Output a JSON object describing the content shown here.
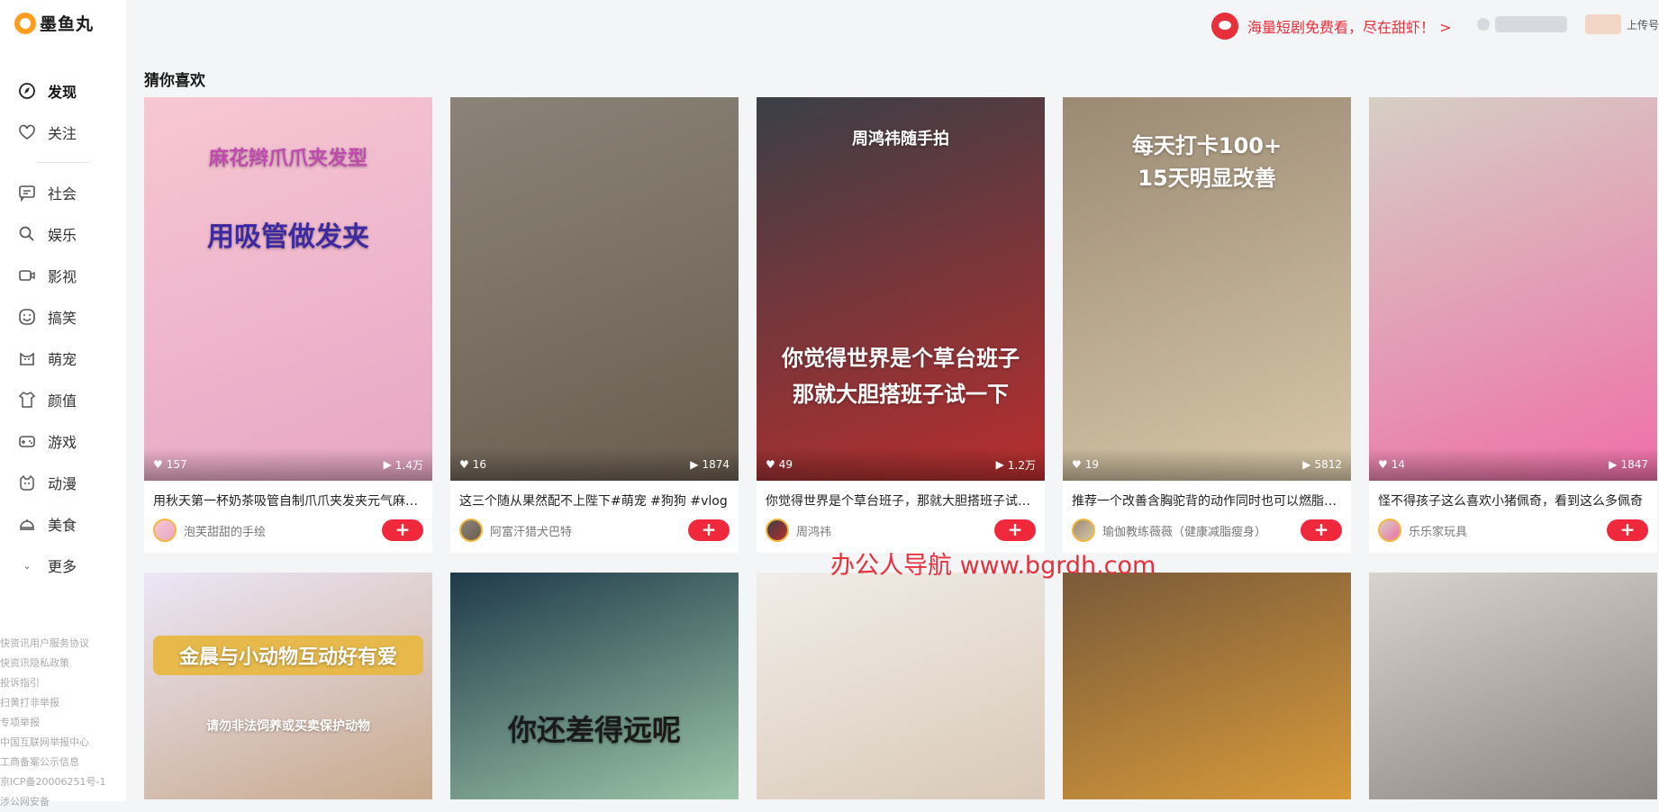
{
  "app": {
    "name": "墨鱼丸"
  },
  "nav": {
    "items": [
      {
        "label": "发现",
        "icon": "compass-icon",
        "active": true
      },
      {
        "label": "关注",
        "icon": "heart-face-icon"
      },
      {
        "label": "社会",
        "icon": "chat-icon"
      },
      {
        "label": "娱乐",
        "icon": "search-icon"
      },
      {
        "label": "影视",
        "icon": "video-camera-icon"
      },
      {
        "label": "搞笑",
        "icon": "smile-icon"
      },
      {
        "label": "萌宠",
        "icon": "cat-icon"
      },
      {
        "label": "颜值",
        "icon": "tshirt-icon"
      },
      {
        "label": "游戏",
        "icon": "gamepad-icon"
      },
      {
        "label": "动漫",
        "icon": "anime-face-icon"
      },
      {
        "label": "美食",
        "icon": "dish-icon"
      }
    ],
    "more": "更多"
  },
  "footer_links": [
    "快资讯用户服务协议",
    "快资讯隐私政策",
    "投诉指引",
    "扫黄打非举报",
    "专项举报",
    "中国互联网举报中心",
    "工商备案公示信息",
    "京ICP备20006251号-1",
    "涉公网安备"
  ],
  "header": {
    "promo": "海量短剧免费看，尽在甜虾！ >",
    "upload": "上传号"
  },
  "section": {
    "title": "猜你喜欢"
  },
  "cards": [
    {
      "title": "用秋天第一杯奶茶吸管自制爪爪夹发夹元气麻花辫",
      "author": "泡芙甜甜的手绘",
      "likes": "157",
      "plays": "1.4万",
      "overlay": [
        "麻花辫爪爪夹发型",
        "用吸管做发夹"
      ],
      "colors": [
        "#f7c7d3",
        "#e7a6c5"
      ]
    },
    {
      "title": "这三个随从果然配不上陛下#萌宠 #狗狗 #vlog",
      "author": "阿富汗猎犬巴特",
      "likes": "16",
      "plays": "1874",
      "overlay": [],
      "colors": [
        "#8b8378",
        "#6a5d4f"
      ]
    },
    {
      "title": "你觉得世界是个草台班子，那就大胆搭班子试一下",
      "author": "周鸿祎",
      "likes": "49",
      "plays": "1.2万",
      "overlay": [
        "周鸿祎随手拍",
        "你觉得世界是个草台班子",
        "那就大胆搭班子试一下"
      ],
      "colors": [
        "#3a3f47",
        "#b92d2d"
      ]
    },
    {
      "title": "推荐一个改善含胸驼背的动作同时也可以燃脂瘦身",
      "author": "瑜伽教练薇薇（健康减脂瘦身）",
      "likes": "19",
      "plays": "5812",
      "overlay": [
        "每天打卡100+",
        "15天明显改善"
      ],
      "colors": [
        "#9b8a74",
        "#d8c8a8"
      ]
    },
    {
      "title": "怪不得孩子这么喜欢小猪佩奇，看到这么多佩奇",
      "author": "乐乐家玩具",
      "likes": "14",
      "plays": "1847",
      "overlay": [],
      "colors": [
        "#d6cfc5",
        "#ef6fa8"
      ]
    },
    {
      "title": "",
      "author": "",
      "likes": "",
      "plays": "",
      "overlay": [
        "金晨与小动物互动好有爱",
        "请勿非法饲养或买卖保护动物"
      ],
      "colors": [
        "#ece6f7",
        "#c8a98c"
      ]
    },
    {
      "title": "",
      "author": "",
      "likes": "",
      "plays": "",
      "overlay": [
        "你还差得远呢"
      ],
      "colors": [
        "#1f3a4a",
        "#9cc6a8"
      ]
    },
    {
      "title": "",
      "author": "",
      "likes": "",
      "plays": "",
      "overlay": [],
      "colors": [
        "#f1ede8",
        "#d9c9b8"
      ]
    },
    {
      "title": "",
      "author": "",
      "likes": "",
      "plays": "",
      "overlay": [],
      "colors": [
        "#7a5a3a",
        "#d79a3a"
      ]
    },
    {
      "title": "",
      "author": "",
      "likes": "",
      "plays": "",
      "overlay": [],
      "colors": [
        "#d8d3cc",
        "#8c8680"
      ]
    }
  ],
  "watermark": "办公人导航  www.bgrdh.com",
  "accent": "#f0283c"
}
